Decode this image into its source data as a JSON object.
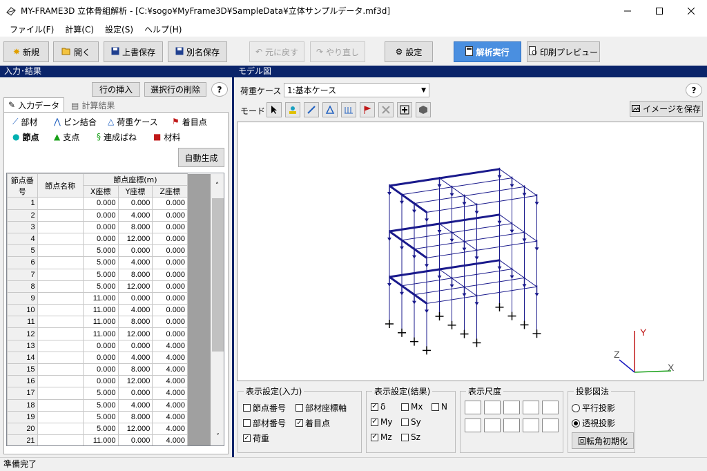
{
  "window": {
    "title": "MY-FRAME3D 立体骨組解析 - [C:¥sogo¥MyFrame3D¥SampleData¥立体サンプルデータ.mf3d]"
  },
  "menu": [
    "ファイル(F)",
    "計算(C)",
    "設定(S)",
    "ヘルプ(H)"
  ],
  "toolbar": {
    "new": "新規",
    "open": "開く",
    "save": "上書保存",
    "save_as": "別名保存",
    "undo": "元に戻す",
    "redo": "やり直し",
    "settings": "設定",
    "run": "解析実行",
    "preview": "印刷プレビュー"
  },
  "left_panel": {
    "title": "入力･結果",
    "insert_row": "行の挿入",
    "delete_row": "選択行の削除",
    "help": "?",
    "tabs": [
      "入力データ",
      "計算結果"
    ],
    "subtabs_row1": [
      "部材",
      "ピン結合",
      "荷重ケース",
      "着目点"
    ],
    "subtabs_row2": [
      "節点",
      "支点",
      "連成ばね",
      "材料"
    ],
    "auto_generate": "自動生成",
    "table": {
      "header_no": "節点番号",
      "header_name": "節点名称",
      "header_group": "節点座標(m)",
      "header_x": "X座標",
      "header_y": "Y座標",
      "header_z": "Z座標",
      "rows": [
        [
          "1",
          "",
          "0.000",
          "0.000",
          "0.000"
        ],
        [
          "2",
          "",
          "0.000",
          "4.000",
          "0.000"
        ],
        [
          "3",
          "",
          "0.000",
          "8.000",
          "0.000"
        ],
        [
          "4",
          "",
          "0.000",
          "12.000",
          "0.000"
        ],
        [
          "5",
          "",
          "5.000",
          "0.000",
          "0.000"
        ],
        [
          "6",
          "",
          "5.000",
          "4.000",
          "0.000"
        ],
        [
          "7",
          "",
          "5.000",
          "8.000",
          "0.000"
        ],
        [
          "8",
          "",
          "5.000",
          "12.000",
          "0.000"
        ],
        [
          "9",
          "",
          "11.000",
          "0.000",
          "0.000"
        ],
        [
          "10",
          "",
          "11.000",
          "4.000",
          "0.000"
        ],
        [
          "11",
          "",
          "11.000",
          "8.000",
          "0.000"
        ],
        [
          "12",
          "",
          "11.000",
          "12.000",
          "0.000"
        ],
        [
          "13",
          "",
          "0.000",
          "0.000",
          "4.000"
        ],
        [
          "14",
          "",
          "0.000",
          "4.000",
          "4.000"
        ],
        [
          "15",
          "",
          "0.000",
          "8.000",
          "4.000"
        ],
        [
          "16",
          "",
          "0.000",
          "12.000",
          "4.000"
        ],
        [
          "17",
          "",
          "5.000",
          "0.000",
          "4.000"
        ],
        [
          "18",
          "",
          "5.000",
          "4.000",
          "4.000"
        ],
        [
          "19",
          "",
          "5.000",
          "8.000",
          "4.000"
        ],
        [
          "20",
          "",
          "5.000",
          "12.000",
          "4.000"
        ],
        [
          "21",
          "",
          "11.000",
          "0.000",
          "4.000"
        ]
      ]
    }
  },
  "right_panel": {
    "title": "モデル図",
    "load_case_label": "荷重ケース",
    "load_case_value": "1:基本ケース",
    "mode_label": "モード",
    "save_image": "イメージを保存",
    "help": "?",
    "axis_labels": {
      "x": "X",
      "y": "Y",
      "z": "Z"
    },
    "display_input": {
      "title": "表示設定(入力)",
      "items": [
        {
          "label": "節点番号",
          "checked": false
        },
        {
          "label": "部材座標軸",
          "checked": false
        },
        {
          "label": "部材番号",
          "checked": false
        },
        {
          "label": "着目点",
          "checked": true
        },
        {
          "label": "荷重",
          "checked": true
        }
      ]
    },
    "display_result": {
      "title": "表示設定(結果)",
      "items": [
        {
          "label": "δ",
          "checked": true
        },
        {
          "label": "Mx",
          "checked": false
        },
        {
          "label": "N",
          "checked": false
        },
        {
          "label": "My",
          "checked": true
        },
        {
          "label": "Sy",
          "checked": false
        },
        {
          "label": "Mz",
          "checked": true
        },
        {
          "label": "Sz",
          "checked": false
        }
      ]
    },
    "scale": {
      "title": "表示尺度"
    },
    "projection": {
      "title": "投影図法",
      "options": [
        {
          "label": "平行投影",
          "selected": false
        },
        {
          "label": "透視投影",
          "selected": true
        }
      ],
      "reset": "回転角初期化"
    }
  },
  "status": "準備完了",
  "colors": {
    "accent": "#0a246a",
    "primary": "#4a8fe0",
    "frame": "#1a1a8c"
  }
}
